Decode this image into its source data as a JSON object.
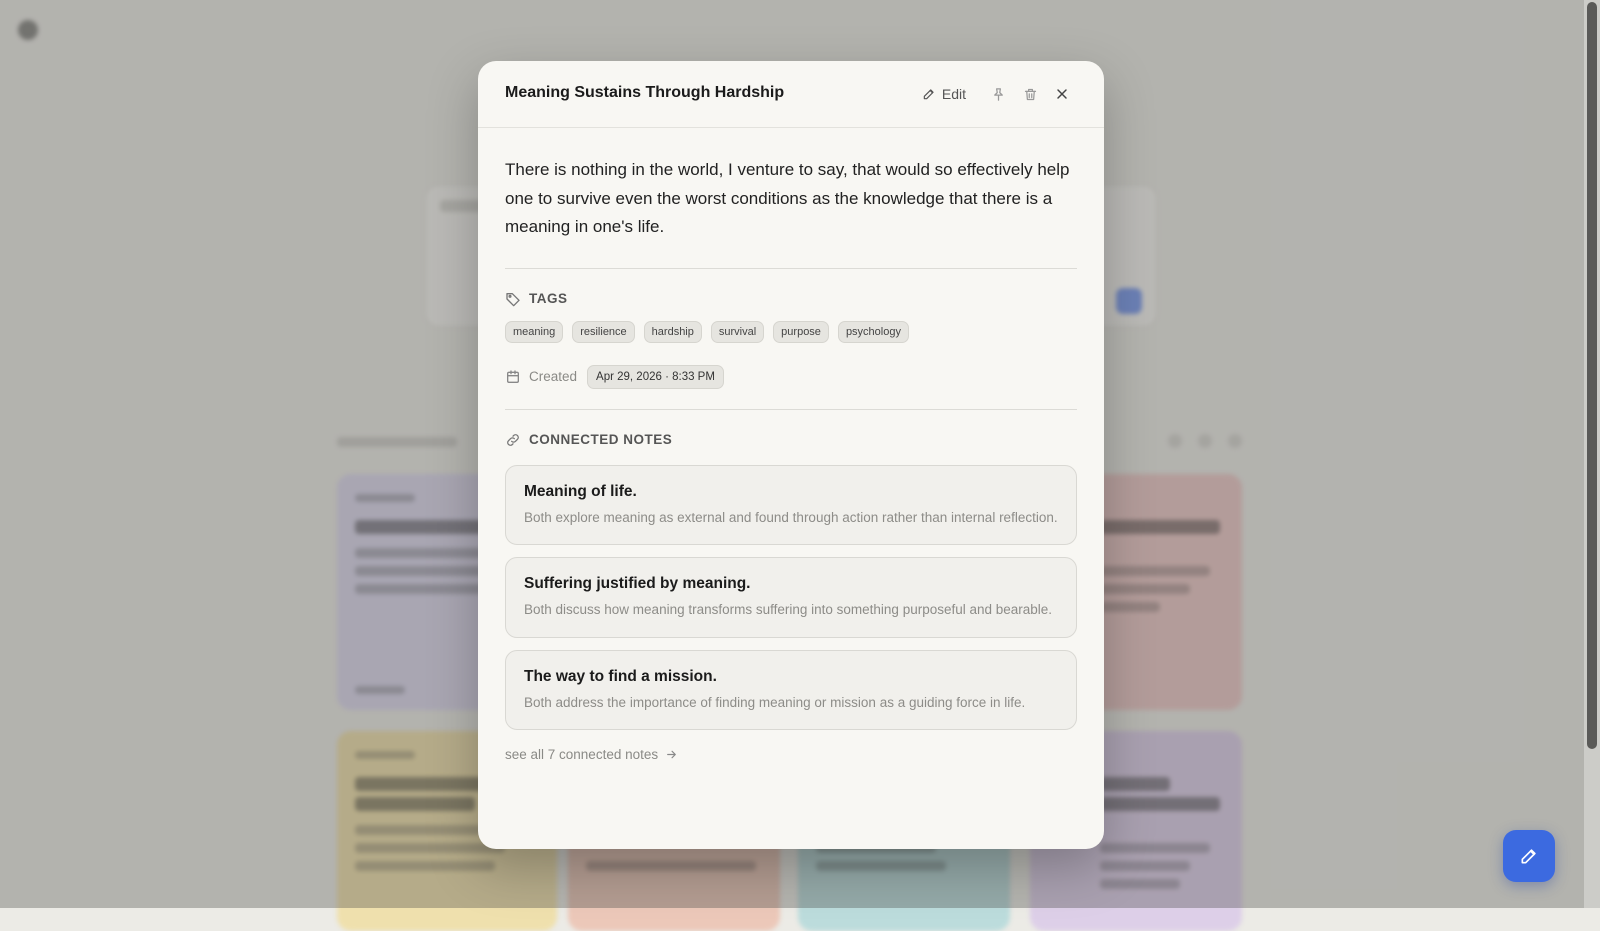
{
  "colors": {
    "accent": "#3c6ae0",
    "modal_bg": "#f8f7f3",
    "scrim": "rgba(70,70,68,0.34)"
  },
  "modal": {
    "title": "Meaning Sustains Through Hardship",
    "edit_label": "Edit",
    "body": "There is nothing in the world, I venture to say, that would so effectively help one to survive even the worst conditions as the knowledge that there is a meaning in one's life.",
    "tags_heading": "TAGS",
    "tags": [
      "meaning",
      "resilience",
      "hardship",
      "survival",
      "purpose",
      "psychology"
    ],
    "created_label": "Created",
    "created_value": "Apr 29, 2026 · 8:33 PM",
    "connected_heading": "CONNECTED NOTES",
    "connected_notes": [
      {
        "title": "Meaning of life.",
        "description": "Both explore meaning as external and found through action rather than internal reflection."
      },
      {
        "title": "Suffering justified by meaning.",
        "description": "Both discuss how meaning transforms suffering into something purposeful and bearable."
      },
      {
        "title": "The way to find a mission.",
        "description": "Both address the importance of finding meaning or mission as a guiding force in life."
      }
    ],
    "see_all_label": "see all 7 connected notes"
  },
  "icons": {
    "edit": "pencil-icon",
    "pin": "pin-icon",
    "delete": "trash-icon",
    "close": "close-icon",
    "tags": "tag-icon",
    "created": "calendar-icon",
    "connected": "link-icon",
    "see_all": "arrow-right-icon",
    "fab": "pencil-icon"
  }
}
